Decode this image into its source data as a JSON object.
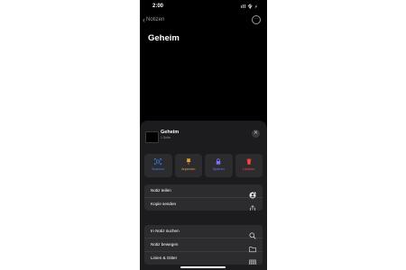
{
  "status_bar": {
    "time": "2:00",
    "indicators": "ıll 令 ⚡"
  },
  "nav": {
    "back_label": "Notizen",
    "more_icon": "ellipsis-circle-icon"
  },
  "note": {
    "title": "Geheim"
  },
  "sheet": {
    "title": "Geheim",
    "subtitle": "1 Seite",
    "actions": [
      {
        "label": "Scannen",
        "icon": "scan-icon",
        "color": "#3a82f7"
      },
      {
        "label": "Anpinnen",
        "icon": "pin-icon",
        "color": "#e8a33d"
      },
      {
        "label": "Sperren",
        "icon": "lock-icon",
        "color": "#7b72f5"
      },
      {
        "label": "Löschen",
        "icon": "trash-icon",
        "color": "#ff453a"
      }
    ],
    "group1": [
      {
        "label": "Notiz teilen",
        "icon": "share-person-icon"
      },
      {
        "label": "Kopie senden",
        "icon": "share-icon"
      }
    ],
    "group2": [
      {
        "label": "In Notiz suchen",
        "icon": "search-icon"
      },
      {
        "label": "Notiz bewegen",
        "icon": "folder-icon"
      },
      {
        "label": "Linien & Gitter",
        "icon": "grid-icon"
      }
    ]
  }
}
